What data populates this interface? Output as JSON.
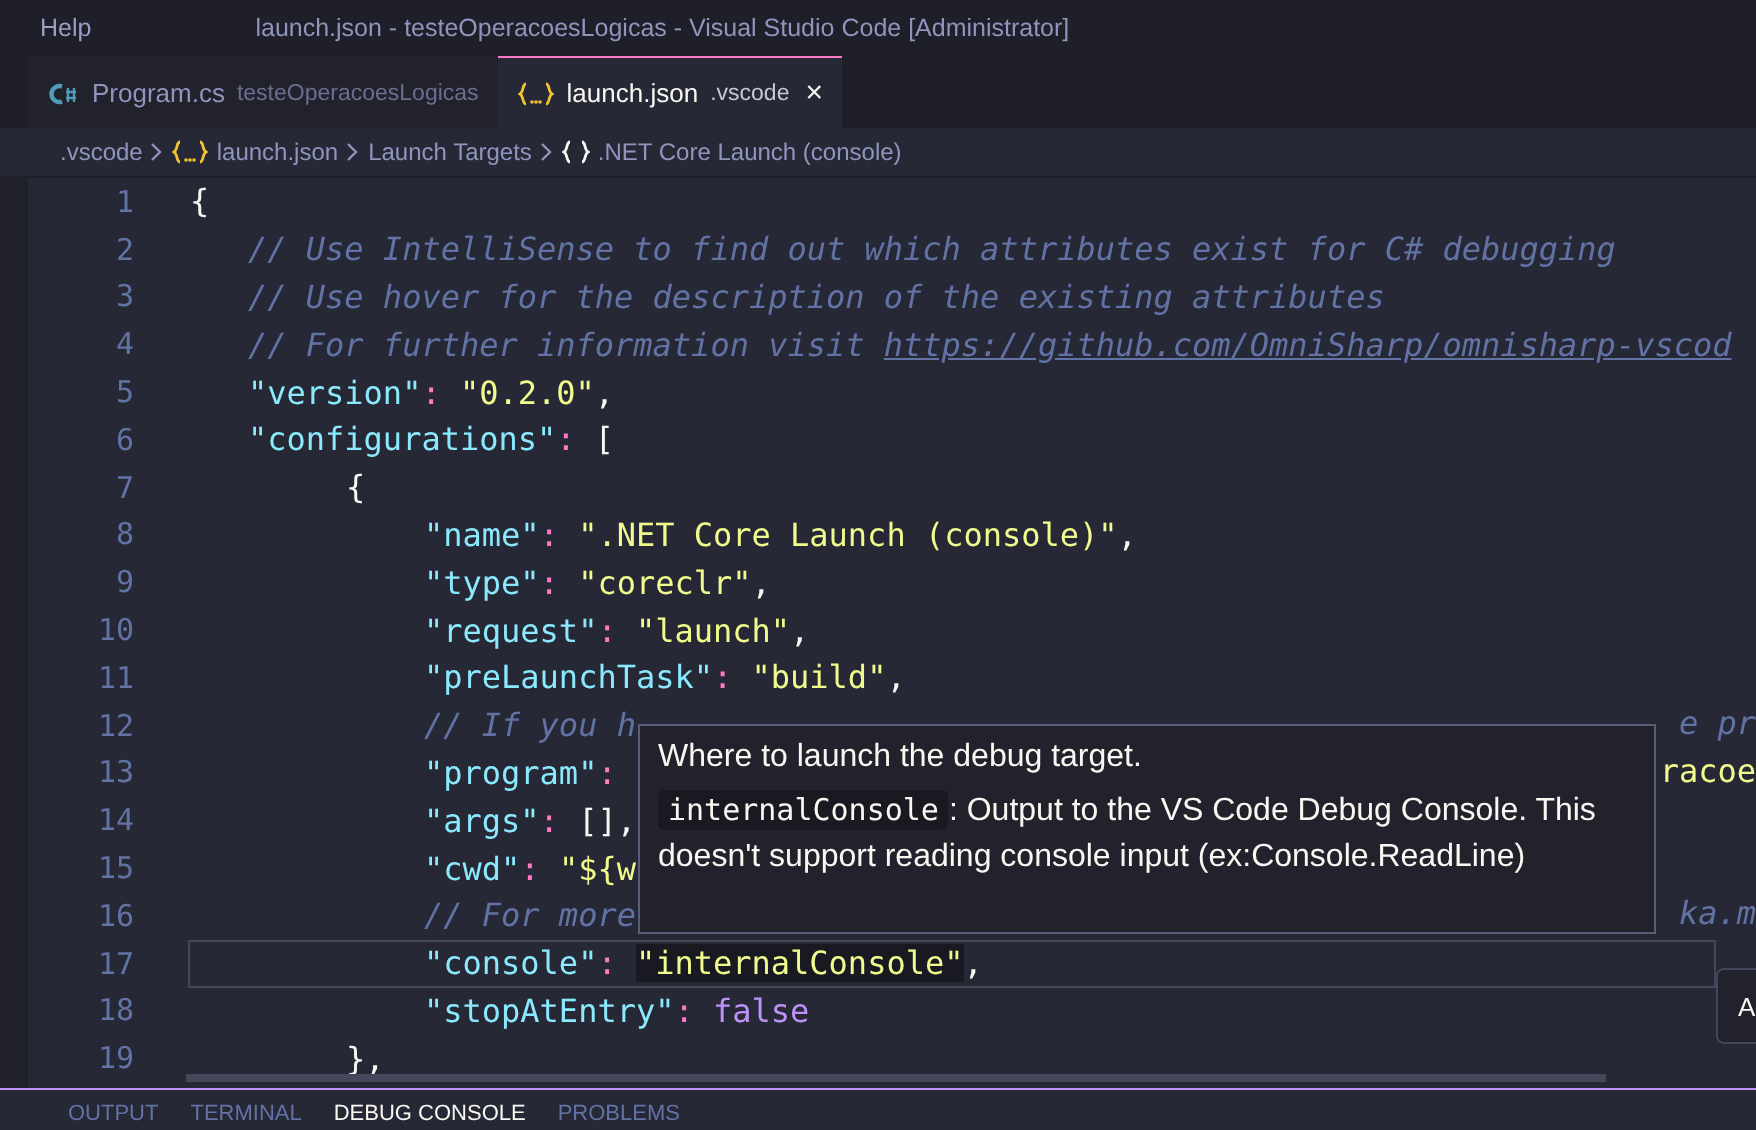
{
  "menu": [
    "Help"
  ],
  "window": {
    "title": "launch.json - testeOperacoesLogicas - Visual Studio Code [Administrator]"
  },
  "tabs": [
    {
      "label": "Program.cs",
      "detail": "testeOperacoesLogicas",
      "selected": false
    },
    {
      "label": "launch.json",
      "detail": ".vscode",
      "selected": true,
      "close": "×"
    }
  ],
  "breadcrumb": [
    {
      "label": ".vscode"
    },
    {
      "label": "launch.json"
    },
    {
      "label": "Launch Targets"
    },
    {
      "label": ".NET Core Launch (console)"
    }
  ],
  "editor": {
    "lines": [
      {
        "number": "1",
        "tokens": [
          {
            "kind": "punct",
            "text": "{"
          }
        ],
        "children": [
          {
            "number": "2",
            "tokens": [
              {
                "kind": "comment",
                "text": "// Use IntelliSense to find out which attributes exist for C# debugging"
              }
            ]
          },
          {
            "number": "3",
            "tokens": [
              {
                "kind": "comment",
                "text": "// Use hover for the description of the existing attributes"
              }
            ]
          },
          {
            "number": "4",
            "tokens": [
              {
                "kind": "comment",
                "text": "// For further information visit "
              },
              {
                "kind": "link",
                "text": "https://github.com/OmniSharp/omnisharp-vscod"
              }
            ]
          },
          {
            "number": "5",
            "tokens": [
              {
                "kind": "key",
                "text": "\"version\""
              },
              {
                "kind": "colon",
                "text": ": "
              },
              {
                "kind": "string",
                "text": "\"0.2.0\""
              },
              {
                "kind": "punct",
                "text": ","
              }
            ]
          },
          {
            "number": "6",
            "tokens": [
              {
                "kind": "key",
                "text": "\"configurations\""
              },
              {
                "kind": "colon",
                "text": ": "
              },
              {
                "kind": "punct",
                "text": "["
              }
            ],
            "children": [
              {
                "number": "7",
                "tokens": [
                  {
                    "kind": "punct",
                    "text": "{"
                  }
                ],
                "children": [
                  {
                    "number": "8",
                    "tokens": [
                      {
                        "kind": "key",
                        "text": "\"name\""
                      },
                      {
                        "kind": "colon",
                        "text": ": "
                      },
                      {
                        "kind": "string",
                        "text": "\".NET Core Launch (console)\""
                      },
                      {
                        "kind": "punct",
                        "text": ","
                      }
                    ]
                  },
                  {
                    "number": "9",
                    "tokens": [
                      {
                        "kind": "key",
                        "text": "\"type\""
                      },
                      {
                        "kind": "colon",
                        "text": ": "
                      },
                      {
                        "kind": "string",
                        "text": "\"coreclr\""
                      },
                      {
                        "kind": "punct",
                        "text": ","
                      }
                    ]
                  },
                  {
                    "number": "10",
                    "tokens": [
                      {
                        "kind": "key",
                        "text": "\"request\""
                      },
                      {
                        "kind": "colon",
                        "text": ": "
                      },
                      {
                        "kind": "string",
                        "text": "\"launch\""
                      },
                      {
                        "kind": "punct",
                        "text": ","
                      }
                    ]
                  },
                  {
                    "number": "11",
                    "tokens": [
                      {
                        "kind": "key",
                        "text": "\"preLaunchTask\""
                      },
                      {
                        "kind": "colon",
                        "text": ": "
                      },
                      {
                        "kind": "string",
                        "text": "\"build\""
                      },
                      {
                        "kind": "punct",
                        "text": ","
                      }
                    ]
                  },
                  {
                    "number": "12",
                    "tokens": [
                      {
                        "kind": "comment",
                        "text": "// If you h"
                      }
                    ],
                    "tail": {
                      "kind": "comment",
                      "text": "e pr"
                    }
                  },
                  {
                    "number": "13",
                    "tokens": [
                      {
                        "kind": "key",
                        "text": "\"program\""
                      },
                      {
                        "kind": "colon",
                        "text": ": "
                      }
                    ],
                    "tail": {
                      "kind": "string",
                      "text": "racoe"
                    }
                  },
                  {
                    "number": "14",
                    "tokens": [
                      {
                        "kind": "key",
                        "text": "\"args\""
                      },
                      {
                        "kind": "colon",
                        "text": ": "
                      },
                      {
                        "kind": "punct",
                        "text": "[],"
                      }
                    ]
                  },
                  {
                    "number": "15",
                    "tokens": [
                      {
                        "kind": "key",
                        "text": "\"cwd\""
                      },
                      {
                        "kind": "colon",
                        "text": ": "
                      },
                      {
                        "kind": "string",
                        "text": "\"${w"
                      }
                    ]
                  },
                  {
                    "number": "16",
                    "tokens": [
                      {
                        "kind": "comment",
                        "text": "// For more"
                      }
                    ],
                    "tail": {
                      "kind": "comment",
                      "text": "ka.m"
                    }
                  },
                  {
                    "number": "17",
                    "current": true,
                    "tokens": [
                      {
                        "kind": "key",
                        "text": "\"console\""
                      },
                      {
                        "kind": "colon",
                        "text": ": "
                      },
                      {
                        "kind": "hovered",
                        "text": "\"internalConsole\""
                      },
                      {
                        "kind": "punct",
                        "text": ","
                      }
                    ]
                  },
                  {
                    "number": "18",
                    "tokens": [
                      {
                        "kind": "key",
                        "text": "\"stopAtEntry\""
                      },
                      {
                        "kind": "colon",
                        "text": ": "
                      },
                      {
                        "kind": "boolean",
                        "text": "false"
                      }
                    ]
                  }
                ]
              },
              {
                "number": "19",
                "tokens": [
                  {
                    "kind": "punct",
                    "text": "},"
                  }
                ]
              }
            ]
          }
        ]
      }
    ]
  },
  "hover": {
    "title": "Where to launch the debug target.",
    "code": "internalConsole",
    "description": ": Output to the VS Code Debug Console. This doesn't support reading console input (ex:Console.ReadLine)"
  },
  "side_button": {
    "label": "A"
  },
  "panel_tabs": [
    {
      "label": "OUTPUT",
      "selected": false
    },
    {
      "label": "TERMINAL",
      "selected": false
    },
    {
      "label": "DEBUG CONSOLE",
      "selected": true
    },
    {
      "label": "PROBLEMS",
      "selected": false
    }
  ]
}
